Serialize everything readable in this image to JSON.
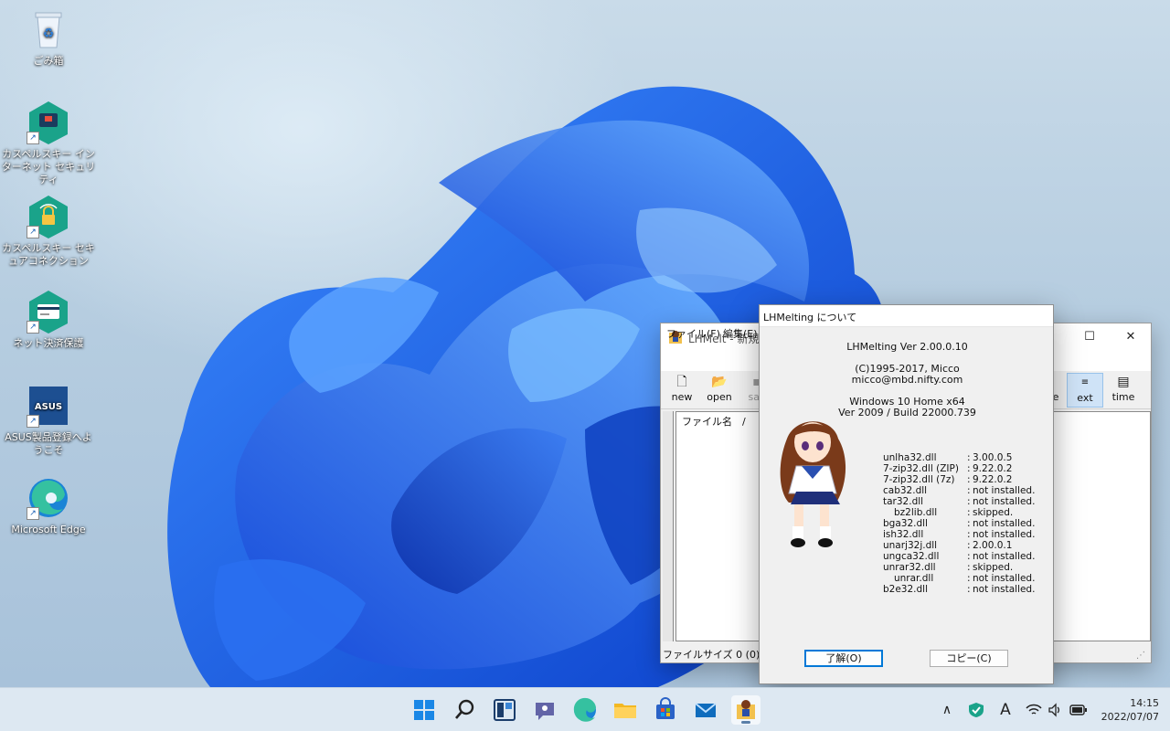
{
  "desktop": {
    "icons": [
      {
        "label": "ごみ箱",
        "icon": "recycle-bin-icon"
      },
      {
        "label": "カスペルスキー インターネット セキュリティ",
        "icon": "kaspersky-security-icon"
      },
      {
        "label": "カスペルスキー セキュアコネクション",
        "icon": "kaspersky-vpn-icon"
      },
      {
        "label": "ネット決済保護",
        "icon": "kaspersky-payment-icon"
      },
      {
        "label": "ASUS製品登録へようこそ",
        "icon": "asus-icon"
      },
      {
        "label": "Microsoft Edge",
        "icon": "edge-icon"
      }
    ],
    "shortcut_arrow": "↗"
  },
  "lhmelt": {
    "title": "LHMelt - 新規",
    "menus": [
      "ファイル(F)",
      "編集(E)"
    ],
    "toolbar": [
      {
        "label": "new",
        "icon": "new-file-icon"
      },
      {
        "label": "open",
        "icon": "open-folder-icon"
      },
      {
        "label": "sav",
        "icon": "save-icon"
      },
      {
        "label": "e",
        "icon": "toolbar-icon"
      },
      {
        "label": "ext",
        "icon": "sort-ext-icon",
        "active": true
      },
      {
        "label": "time",
        "icon": "sort-time-icon"
      }
    ],
    "list_header": "ファイル名　/",
    "status": "ファイルサイズ 0 (0) バイ",
    "window_buttons": {
      "maximize": "☐",
      "close": "✕"
    }
  },
  "about": {
    "title": "LHMelting について",
    "app_version": "LHMelting Ver 2.00.0.10",
    "copyright": "(C)1995-2017, Micco",
    "email": "micco@mbd.nifty.com",
    "os": "Windows 10 Home  x64",
    "os_build": "Ver 2009 / Build 22000.739",
    "dlls": [
      {
        "name": "unlha32.dll",
        "value": "3.00.0.5",
        "indent": false
      },
      {
        "name": "7-zip32.dll (ZIP)",
        "value": "9.22.0.2",
        "indent": false
      },
      {
        "name": "7-zip32.dll (7z)",
        "value": "9.22.0.2",
        "indent": false
      },
      {
        "name": "cab32.dll",
        "value": "not installed.",
        "indent": false
      },
      {
        "name": "tar32.dll",
        "value": "not installed.",
        "indent": false
      },
      {
        "name": "bz2lib.dll",
        "value": "skipped.",
        "indent": true
      },
      {
        "name": "bga32.dll",
        "value": "not installed.",
        "indent": false
      },
      {
        "name": "ish32.dll",
        "value": "not installed.",
        "indent": false
      },
      {
        "name": "unarj32j.dll",
        "value": "2.00.0.1",
        "indent": false
      },
      {
        "name": "ungca32.dll",
        "value": "not installed.",
        "indent": false
      },
      {
        "name": "unrar32.dll",
        "value": "skipped.",
        "indent": false
      },
      {
        "name": "unrar.dll",
        "value": "not installed.",
        "indent": true
      },
      {
        "name": "b2e32.dll",
        "value": "not installed.",
        "indent": false
      }
    ],
    "colon": ":",
    "ok_button": "了解(O)",
    "copy_button": "コピー(C)"
  },
  "taskbar": {
    "pinned": [
      {
        "name": "start-button",
        "icon": "windows-logo-icon"
      },
      {
        "name": "search-button",
        "icon": "search-icon"
      },
      {
        "name": "widgets-button",
        "icon": "widgets-icon"
      },
      {
        "name": "teams-chat-button",
        "icon": "teams-chat-icon"
      },
      {
        "name": "edge-button",
        "icon": "edge-icon"
      },
      {
        "name": "file-explorer-button",
        "icon": "folder-icon"
      },
      {
        "name": "store-button",
        "icon": "store-icon"
      },
      {
        "name": "mail-button",
        "icon": "mail-icon"
      },
      {
        "name": "lhmelt-button",
        "icon": "lhmelt-icon",
        "active": true
      }
    ],
    "tray": {
      "chevron": "∧",
      "ime": "A",
      "wifi": "wifi-icon",
      "volume": "volume-icon",
      "battery": "battery-icon"
    },
    "time": "14:15",
    "date": "2022/07/07"
  },
  "colors": {
    "accent": "#0078d7",
    "kaspersky": "#1aa38a",
    "asus": "#1d4f91",
    "bloom": "#1f66e8"
  }
}
